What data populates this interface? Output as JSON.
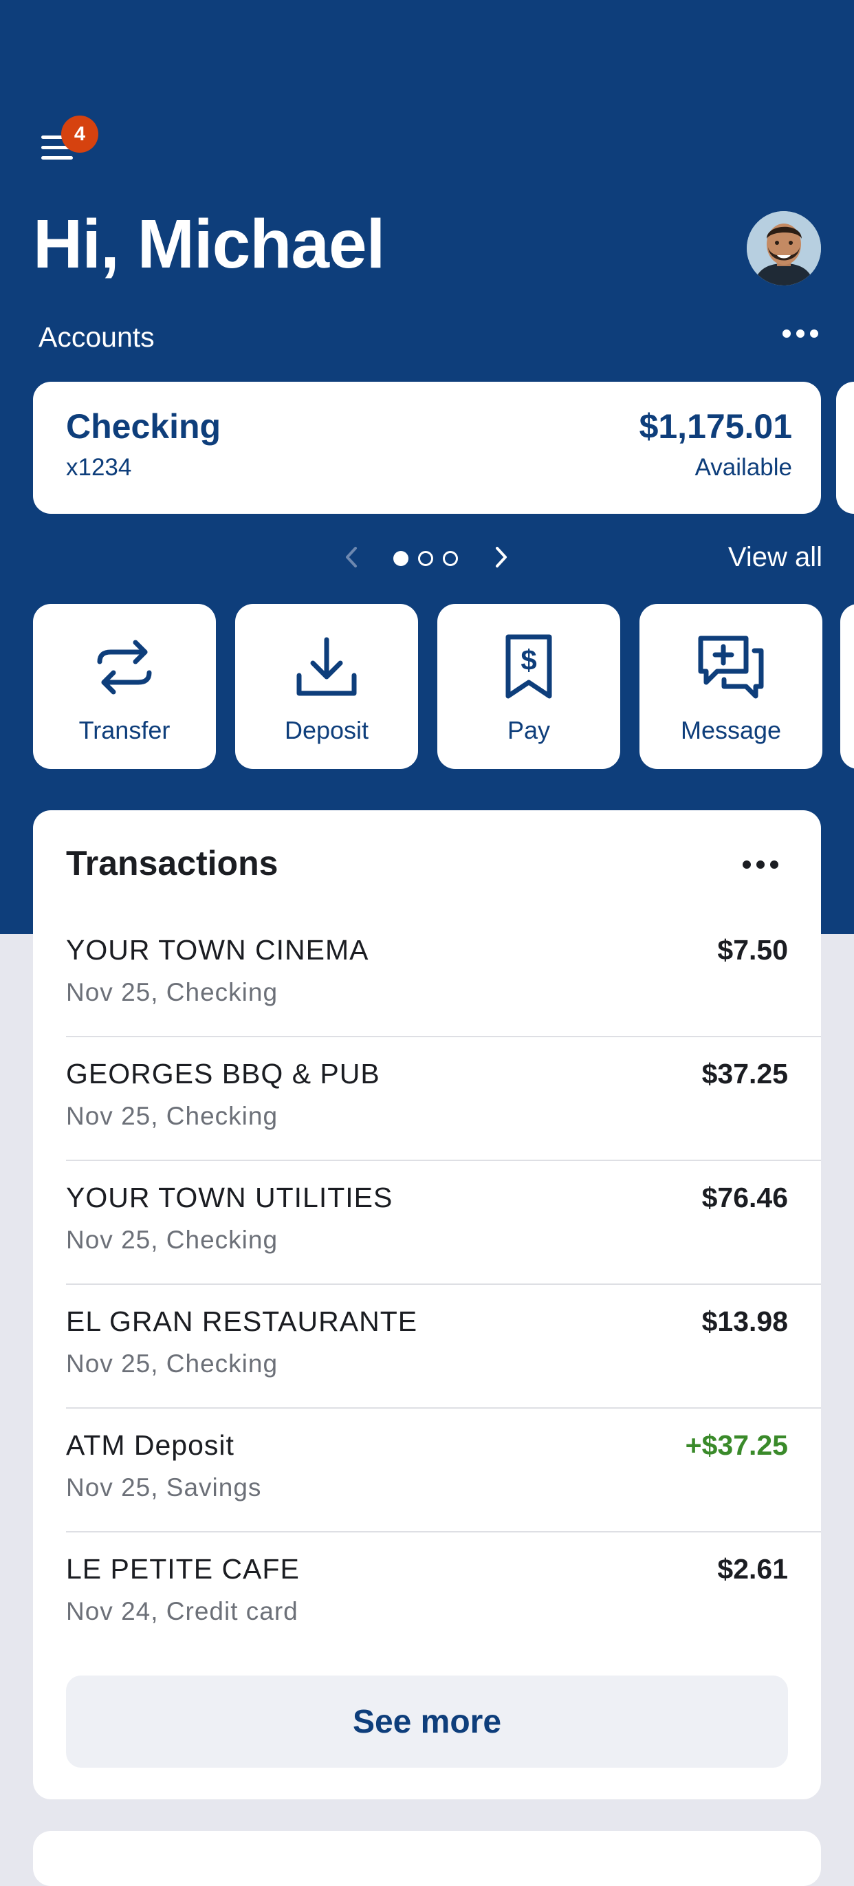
{
  "header": {
    "notification_count": "4",
    "greeting": "Hi, Michael"
  },
  "accounts": {
    "section_label": "Accounts",
    "card": {
      "name": "Checking",
      "number": "x1234",
      "balance": "$1,175.01",
      "balance_label": "Available"
    },
    "pager": {
      "page_count": 3,
      "current_page": 1
    },
    "view_all_label": "View all"
  },
  "actions": [
    {
      "label": "Transfer",
      "icon": "transfer-arrows-icon"
    },
    {
      "label": "Deposit",
      "icon": "download-tray-icon"
    },
    {
      "label": "Pay",
      "icon": "dollar-receipt-icon"
    },
    {
      "label": "Message",
      "icon": "chat-plus-icon"
    }
  ],
  "transactions": {
    "title": "Transactions",
    "items": [
      {
        "merchant": "YOUR TOWN CINEMA",
        "meta": "Nov 25, Checking",
        "amount": "$7.50"
      },
      {
        "merchant": "GEORGES BBQ & PUB",
        "meta": "Nov 25, Checking",
        "amount": "$37.25"
      },
      {
        "merchant": "YOUR TOWN UTILITIES",
        "meta": "Nov 25, Checking",
        "amount": "$76.46"
      },
      {
        "merchant": "EL GRAN RESTAURANTE",
        "meta": "Nov 25, Checking",
        "amount": "$13.98"
      },
      {
        "merchant": "ATM Deposit",
        "meta": "Nov 25, Savings",
        "amount": "+$37.25"
      },
      {
        "merchant": "LE PETITE CAFE",
        "meta": "Nov 24, Credit card",
        "amount": "$2.61"
      }
    ],
    "see_more_label": "See more"
  },
  "colors": {
    "brand_navy": "#0e3e7b",
    "badge_orange": "#d6420f",
    "credit_green": "#3a8a2a",
    "page_background": "#e6e7ee"
  }
}
